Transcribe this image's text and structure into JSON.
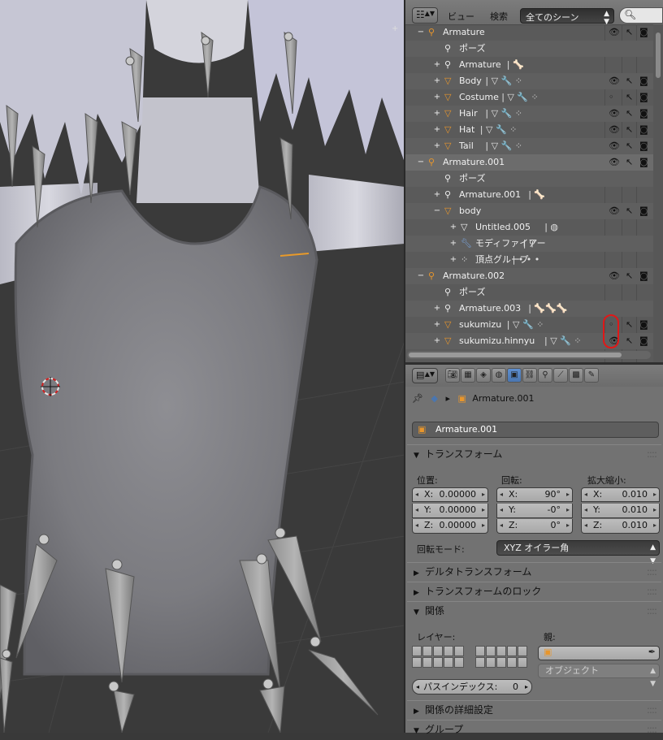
{
  "outliner": {
    "menu_view": "ビュー",
    "menu_search": "検索",
    "scene_filter": "全てのシーン",
    "rows": [
      {
        "label": "Armature",
        "indent": 0,
        "expander": "−",
        "icon": "armature",
        "eye": "👁"
      },
      {
        "label": "ポーズ",
        "indent": 1,
        "expander": "",
        "icon": "pose",
        "eye": ""
      },
      {
        "label": "Armature",
        "indent": 1,
        "expander": "+",
        "icon": "armature-data",
        "eye": "",
        "extras": "| 🦴"
      },
      {
        "label": "Body",
        "indent": 1,
        "expander": "+",
        "icon": "mesh",
        "eye": "👁",
        "extras": "| ▽ 🔧 ⁘"
      },
      {
        "label": "Costume",
        "indent": 1,
        "expander": "+",
        "icon": "mesh",
        "eye": "◦",
        "extras": "| ▽ 🔧 ⁘"
      },
      {
        "label": "Hair",
        "indent": 1,
        "expander": "+",
        "icon": "mesh",
        "eye": "👁",
        "extras": "| ▽ 🔧 ⁘"
      },
      {
        "label": "Hat",
        "indent": 1,
        "expander": "+",
        "icon": "mesh",
        "eye": "👁",
        "extras": "| ▽ 🔧 ⁘"
      },
      {
        "label": "Tail",
        "indent": 1,
        "expander": "+",
        "icon": "mesh",
        "eye": "👁",
        "extras": "| ▽ 🔧 ⁘"
      },
      {
        "label": "Armature.001",
        "indent": 0,
        "expander": "−",
        "icon": "armature",
        "eye": "👁",
        "selected": true
      },
      {
        "label": "ポーズ",
        "indent": 1,
        "expander": "",
        "icon": "pose",
        "eye": ""
      },
      {
        "label": "Armature.001",
        "indent": 1,
        "expander": "+",
        "icon": "armature-data",
        "eye": "",
        "extras": "| 🦴"
      },
      {
        "label": "body",
        "indent": 1,
        "expander": "−",
        "icon": "mesh",
        "eye": "👁"
      },
      {
        "label": "Untitled.005",
        "indent": 2,
        "expander": "+",
        "icon": "mesh-data",
        "eye": "",
        "extras": "| ◍"
      },
      {
        "label": "モディファイアー",
        "indent": 2,
        "expander": "+",
        "icon": "wrench",
        "eye": "",
        "extras": "| ⚲"
      },
      {
        "label": "頂点グループ",
        "indent": 2,
        "expander": "+",
        "icon": "vgroup",
        "eye": "",
        "extras": "| • • •"
      },
      {
        "label": "Armature.002",
        "indent": 0,
        "expander": "−",
        "icon": "armature",
        "eye": "👁"
      },
      {
        "label": "ポーズ",
        "indent": 1,
        "expander": "",
        "icon": "pose",
        "eye": ""
      },
      {
        "label": "Armature.003",
        "indent": 1,
        "expander": "+",
        "icon": "armature-data",
        "eye": "",
        "extras": "| 🦴🦴🦴"
      },
      {
        "label": "sukumizu",
        "indent": 1,
        "expander": "+",
        "icon": "mesh",
        "eye": "◦",
        "extras": "| ▽ 🔧 ⁘"
      },
      {
        "label": "sukumizu.hinnyu",
        "indent": 1,
        "expander": "+",
        "icon": "mesh",
        "eye": "👁",
        "extras": "| ▽ 🔧 ⁘"
      }
    ]
  },
  "properties": {
    "breadcrumb": "Armature.001",
    "object_name": "Armature.001",
    "transform_panel": "トランスフォーム",
    "location_label": "位置:",
    "rotation_label": "回転:",
    "scale_label": "拡大縮小:",
    "location": [
      {
        "k": "X:",
        "v": "0.00000"
      },
      {
        "k": "Y:",
        "v": "0.00000"
      },
      {
        "k": "Z:",
        "v": "0.00000"
      }
    ],
    "rotation": [
      {
        "k": "X:",
        "v": "90°"
      },
      {
        "k": "Y:",
        "v": "-0°"
      },
      {
        "k": "Z:",
        "v": "0°"
      }
    ],
    "scale": [
      {
        "k": "X:",
        "v": "0.010"
      },
      {
        "k": "Y:",
        "v": "0.010"
      },
      {
        "k": "Z:",
        "v": "0.010"
      }
    ],
    "rotation_mode_label": "回転モード:",
    "rotation_mode": "XYZ オイラー角",
    "delta_transform_panel": "デルタトランスフォーム",
    "transform_lock_panel": "トランスフォームのロック",
    "relations_panel": "関係",
    "layers_label": "レイヤー:",
    "parent_label": "親:",
    "parent_type": "オブジェクト",
    "pass_index_label": "パスインデックス:",
    "pass_index": "0",
    "relations_extras_panel": "関係の詳細設定",
    "groups_panel": "グループ"
  },
  "colors": {
    "accent": "#5680c2",
    "mesh_icon": "#e8962c",
    "highlight_ring": "#e01818"
  }
}
